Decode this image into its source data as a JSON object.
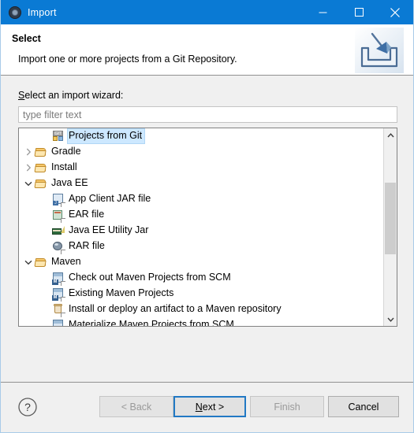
{
  "window": {
    "title": "Import",
    "app_icon": "eclipse-gear-icon",
    "titlebar_color": "#0a7ad4",
    "controls": {
      "minimize": "minimize-icon",
      "maximize": "maximize-icon",
      "close": "close-icon"
    }
  },
  "header": {
    "title": "Select",
    "description": "Import one or more projects from a Git Repository.",
    "graphic": "import-arrow-into-tray-icon"
  },
  "form": {
    "wizard_label_underlined": "S",
    "wizard_label_rest": "elect an import wizard:",
    "filter": {
      "value": "",
      "placeholder": "type filter text"
    }
  },
  "tree": {
    "selection_color": "#cde8ff",
    "items": [
      {
        "label": "Projects from Git",
        "icon": "git-project-icon",
        "indent": 2,
        "twisty": "none",
        "selected": true
      },
      {
        "label": "Gradle",
        "icon": "folder-icon",
        "indent": 0,
        "twisty": "collapsed",
        "selected": false
      },
      {
        "label": "Install",
        "icon": "folder-icon",
        "indent": 0,
        "twisty": "collapsed",
        "selected": false
      },
      {
        "label": "Java EE",
        "icon": "folder-icon",
        "indent": 0,
        "twisty": "expanded",
        "selected": false
      },
      {
        "label": "App Client JAR file",
        "icon": "app-client-jar-icon",
        "indent": 2,
        "twisty": "none",
        "selected": false
      },
      {
        "label": "EAR file",
        "icon": "ear-file-icon",
        "indent": 2,
        "twisty": "none",
        "selected": false
      },
      {
        "label": "Java EE Utility Jar",
        "icon": "utility-jar-icon",
        "indent": 2,
        "twisty": "none",
        "selected": false
      },
      {
        "label": "RAR file",
        "icon": "rar-file-icon",
        "indent": 2,
        "twisty": "none",
        "selected": false
      },
      {
        "label": "Maven",
        "icon": "folder-icon",
        "indent": 0,
        "twisty": "expanded",
        "selected": false
      },
      {
        "label": "Check out Maven Projects from SCM",
        "icon": "maven-project-icon",
        "indent": 2,
        "twisty": "none",
        "selected": false
      },
      {
        "label": "Existing Maven Projects",
        "icon": "maven-project-icon",
        "indent": 2,
        "twisty": "none",
        "selected": false
      },
      {
        "label": "Install or deploy an artifact to a Maven repository",
        "icon": "maven-repository-icon",
        "indent": 2,
        "twisty": "none",
        "selected": false
      },
      {
        "label": "Materialize Maven Projects from SCM",
        "icon": "maven-project-icon",
        "indent": 2,
        "twisty": "none",
        "selected": false
      }
    ],
    "scrollbar": {
      "up_arrow": "chevron-up-icon",
      "down_arrow": "chevron-down-icon"
    }
  },
  "buttons": {
    "help": "?",
    "back": {
      "label": "< Back",
      "underlined": "B",
      "enabled": false
    },
    "next": {
      "label_before": "",
      "underlined": "N",
      "label_after": "ext >",
      "enabled": true,
      "default": true
    },
    "finish": {
      "label": "Finish",
      "underlined": "F",
      "enabled": false
    },
    "cancel": {
      "label": "Cancel",
      "enabled": true
    }
  }
}
